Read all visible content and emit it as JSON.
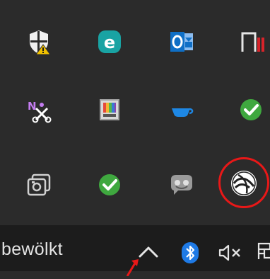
{
  "taskbar": {
    "weather_label": "bewölkt",
    "show_hidden_icons": "chevron-up-icon",
    "bluetooth": "bluetooth-icon",
    "volume": "volume-muted-icon",
    "ime": "ime-icon"
  },
  "tray_icons": [
    {
      "row": 1,
      "col": 1,
      "icon": "windows-security-warning-icon"
    },
    {
      "row": 1,
      "col": 2,
      "icon": "eset-icon"
    },
    {
      "row": 1,
      "col": 3,
      "icon": "outlook-icon"
    },
    {
      "row": 1,
      "col": 4,
      "icon": "red-bars-app-icon"
    },
    {
      "row": 2,
      "col": 1,
      "icon": "onenote-clip-icon"
    },
    {
      "row": 2,
      "col": 2,
      "icon": "color-palette-app-icon"
    },
    {
      "row": 2,
      "col": 3,
      "icon": "cup-icon"
    },
    {
      "row": 2,
      "col": 4,
      "icon": "onedrive-synced-check-icon"
    },
    {
      "row": 3,
      "col": 1,
      "icon": "screenshot-tool-icon"
    },
    {
      "row": 3,
      "col": 2,
      "icon": "sync-check-icon"
    },
    {
      "row": 3,
      "col": 3,
      "icon": "chat-bubble-icon"
    },
    {
      "row": 3,
      "col": 4,
      "icon": "globe-app-icon",
      "highlighted": true
    }
  ],
  "colors": {
    "flyout_bg": "#2b2b2b",
    "taskbar_bg": "#1c1c1c",
    "annotation_red": "#e81818",
    "check_green": "#3fa83f",
    "eset_teal": "#19a3a3",
    "outlook_blue": "#0f6fc6",
    "bluetooth_blue": "#1e7ae6"
  }
}
